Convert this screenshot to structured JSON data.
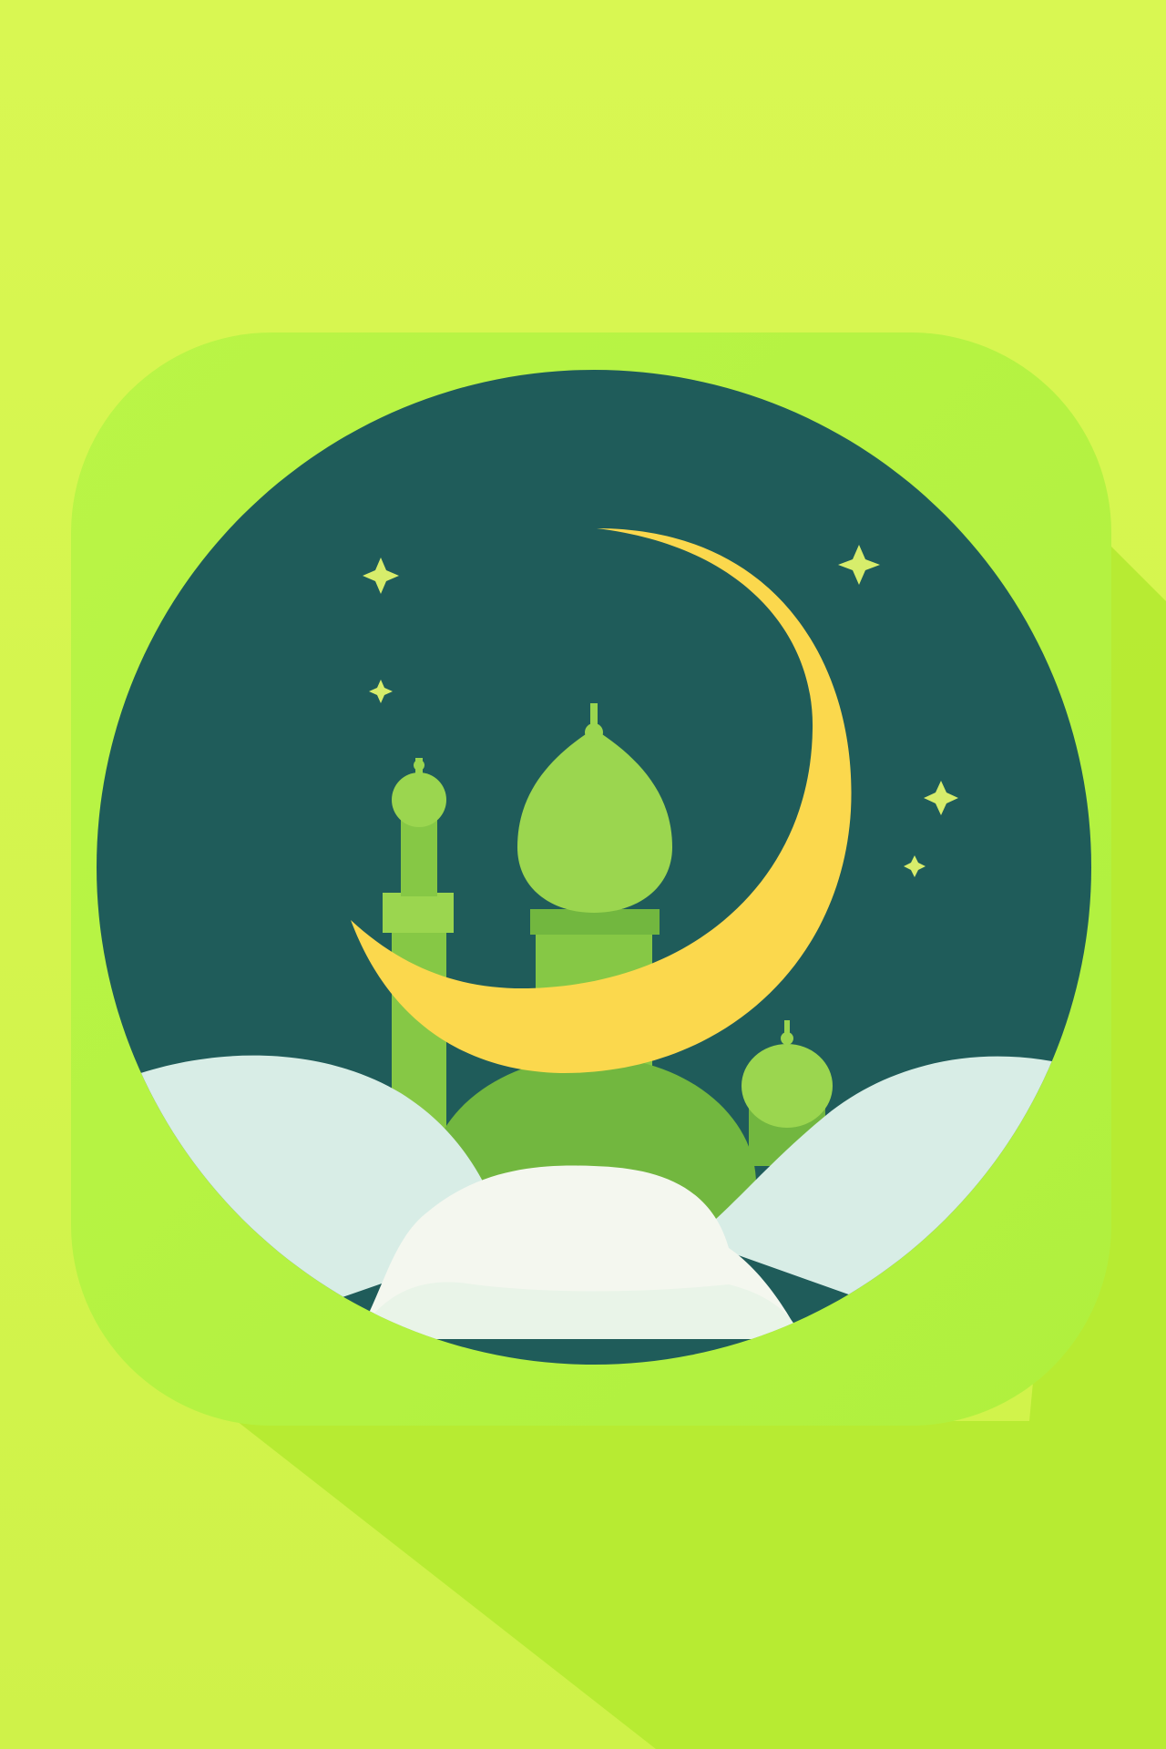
{
  "icon": {
    "subject": "crescent-moon-over-mosque",
    "shape": "rounded-square",
    "shadow": "long-diagonal"
  },
  "colors": {
    "background": "#d9f752",
    "background_edge": "#c8f03a",
    "shadow": "#b4ea30",
    "tile": "#b8f442",
    "tile_inner": "#aeef3c",
    "sky": "#1f5c5a",
    "moon": "#fbd84d",
    "star": "#d7ed6b",
    "mosque_light": "#9bd64f",
    "mosque_mid": "#86c845",
    "mosque_dark": "#72b73f",
    "cloud_back": "#d8ede6",
    "cloud_front": "#f4f7ef"
  },
  "icons": [
    "crescent-moon-icon",
    "star-icon",
    "mosque-icon",
    "cloud-icon"
  ]
}
